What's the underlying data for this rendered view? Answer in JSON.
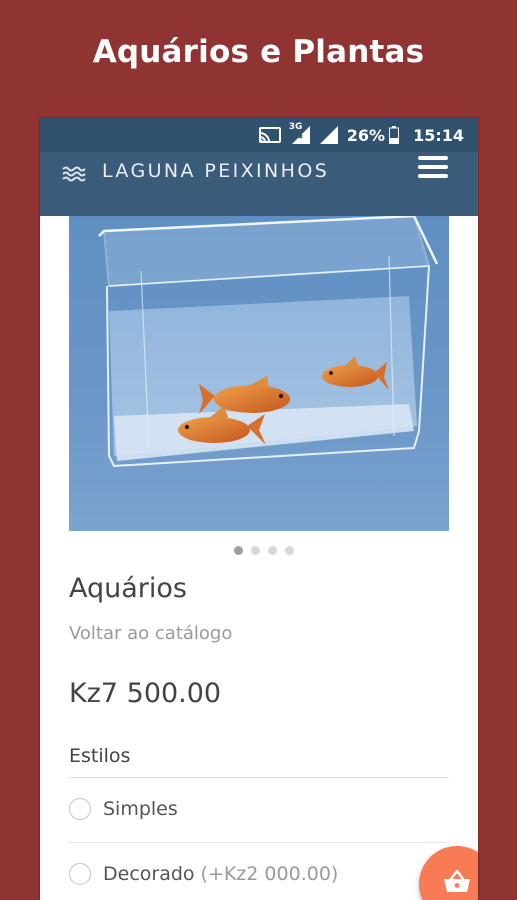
{
  "promo": {
    "title": "Aquários e Plantas"
  },
  "status_bar": {
    "network": "3G",
    "battery": "26%",
    "time": "15:14"
  },
  "app_bar": {
    "brand": "LAGUNA PEIXINHOS",
    "logo_icon": "waves-icon",
    "menu_icon": "hamburger-menu-icon",
    "background": "#3b5b7a",
    "status_background": "#30526f"
  },
  "product": {
    "title": "Aquários",
    "back_link": "Voltar ao catálogo",
    "price": "Kz7 500.00",
    "carousel": {
      "count": 4,
      "active_index": 0
    },
    "styles": {
      "label": "Estilos",
      "options": [
        {
          "label": "Simples",
          "extra": ""
        },
        {
          "label": "Decorado",
          "extra": "(+Kz2 000.00)"
        }
      ]
    }
  },
  "cart_button": {
    "icon": "shopping-basket-icon",
    "color": "#f77c56"
  },
  "colors": {
    "page_background": "#8f3433",
    "accent": "#f77c56"
  }
}
